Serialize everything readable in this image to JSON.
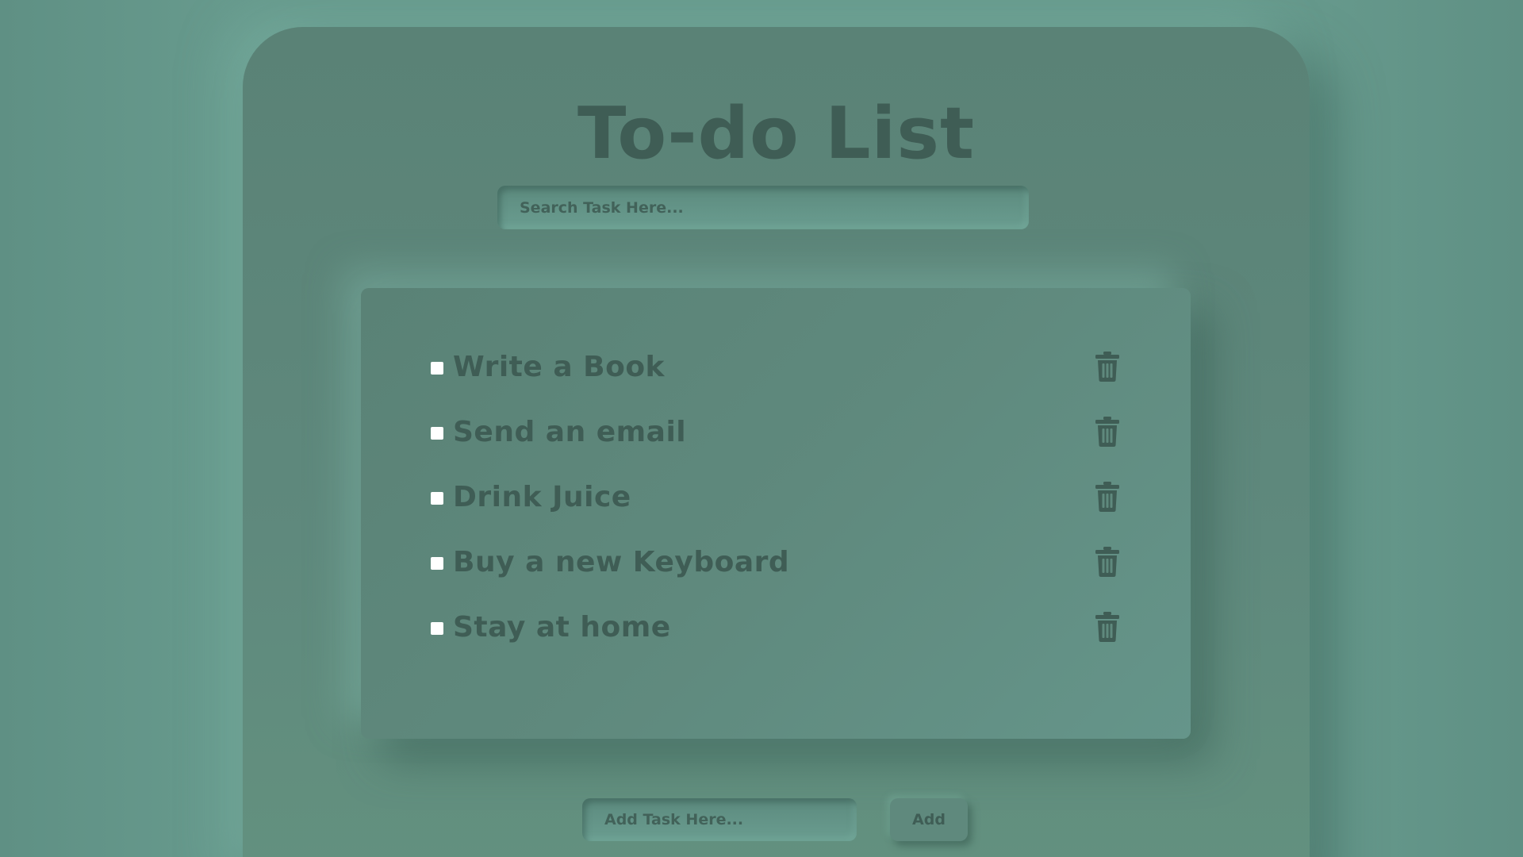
{
  "app": {
    "title": "To-do List"
  },
  "search": {
    "placeholder": "Search Task Here..."
  },
  "tasks": [
    {
      "label": "Write a Book",
      "checked": false
    },
    {
      "label": "Send an email",
      "checked": false
    },
    {
      "label": "Drink Juice",
      "checked": false
    },
    {
      "label": "Buy a new Keyboard",
      "checked": false
    },
    {
      "label": "Stay at home",
      "checked": false
    }
  ],
  "add_task": {
    "placeholder": "Add Task Here...",
    "button_label": "Add"
  },
  "icons": {
    "delete": "trash-icon"
  },
  "colors": {
    "background": "#679a8d",
    "card": "#5f897d",
    "text": "#3f5d55",
    "checkbox": "#ffffff"
  }
}
